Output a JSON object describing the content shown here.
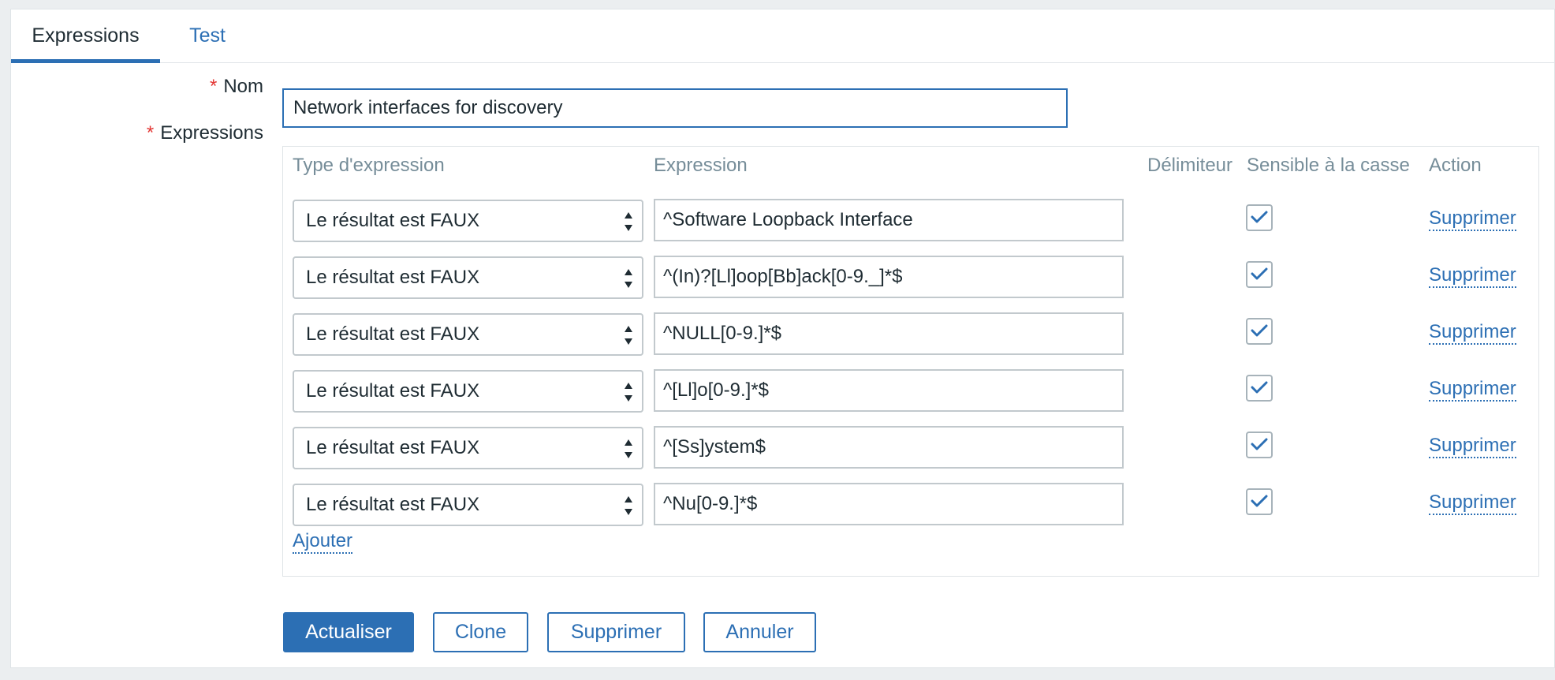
{
  "tabs": [
    {
      "label": "Expressions",
      "active": true
    },
    {
      "label": "Test",
      "active": false
    }
  ],
  "form": {
    "required_marker": "*",
    "name_label": "Nom",
    "name_value": "Network interfaces for discovery",
    "expressions_label": "Expressions"
  },
  "table": {
    "headers": {
      "type": "Type d'expression",
      "expression": "Expression",
      "delimiter": "Délimiteur",
      "case_sensitive": "Sensible à la casse",
      "action": "Action"
    },
    "rows": [
      {
        "type": "Le résultat est FAUX",
        "expression": "^Software Loopback Interface",
        "case_sensitive": true,
        "action": "Supprimer"
      },
      {
        "type": "Le résultat est FAUX",
        "expression": "^(In)?[Ll]oop[Bb]ack[0-9._]*$",
        "case_sensitive": true,
        "action": "Supprimer"
      },
      {
        "type": "Le résultat est FAUX",
        "expression": "^NULL[0-9.]*$",
        "case_sensitive": true,
        "action": "Supprimer"
      },
      {
        "type": "Le résultat est FAUX",
        "expression": "^[Ll]o[0-9.]*$",
        "case_sensitive": true,
        "action": "Supprimer"
      },
      {
        "type": "Le résultat est FAUX",
        "expression": "^[Ss]ystem$",
        "case_sensitive": true,
        "action": "Supprimer"
      },
      {
        "type": "Le résultat est FAUX",
        "expression": "^Nu[0-9.]*$",
        "case_sensitive": true,
        "action": "Supprimer"
      }
    ],
    "add_label": "Ajouter"
  },
  "buttons": {
    "update": "Actualiser",
    "clone": "Clone",
    "delete": "Supprimer",
    "cancel": "Annuler"
  },
  "colors": {
    "accent": "#2c6fb4",
    "required": "#e33734",
    "header_text": "#768d99"
  },
  "icons": {
    "select_arrows": "updown-arrows-icon",
    "checkbox": "checkmark-icon"
  }
}
